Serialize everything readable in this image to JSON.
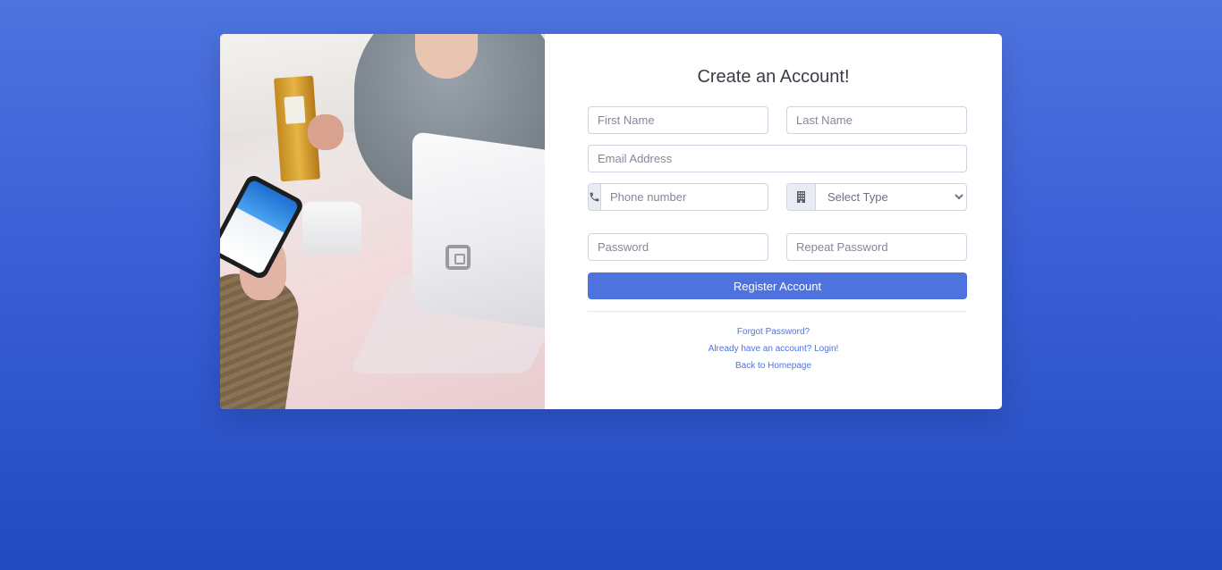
{
  "form": {
    "title": "Create an Account!",
    "first_name_placeholder": "First Name",
    "last_name_placeholder": "Last Name",
    "email_placeholder": "Email Address",
    "phone_placeholder": "Phone number",
    "type_selected": "Select Type",
    "password_placeholder": "Password",
    "repeat_password_placeholder": "Repeat Password",
    "submit_label": "Register Account"
  },
  "links": {
    "forgot": "Forgot Password?",
    "login": "Already have an account? Login!",
    "home": "Back to Homepage"
  },
  "icons": {
    "phone": "phone-icon",
    "type": "building-icon"
  },
  "colors": {
    "primary": "#4e73df",
    "background_top": "#4e73df",
    "background_bottom": "#224abe"
  }
}
